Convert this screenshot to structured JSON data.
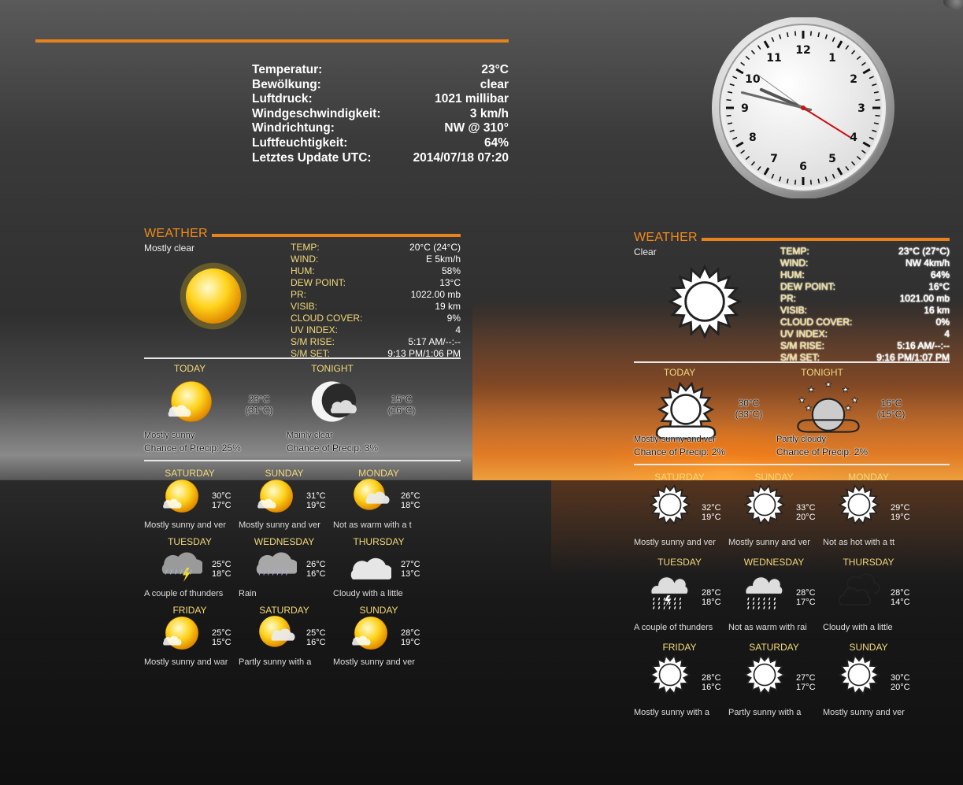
{
  "top_info": {
    "rows": [
      {
        "label": "Temperatur:",
        "value": "23°C"
      },
      {
        "label": "Bewölkung:",
        "value": "clear"
      },
      {
        "label": "Luftdruck:",
        "value": "1021 millibar"
      },
      {
        "label": "Windgeschwindigkeit:",
        "value": "3 km/h"
      },
      {
        "label": "Windrichtung:",
        "value": "NW @ 310°"
      },
      {
        "label": "Luftfeuchtigkeit:",
        "value": "64%"
      },
      {
        "label": "Letztes Update UTC:",
        "value": "2014/07/18 07:20"
      }
    ]
  },
  "clock": {
    "numbers": [
      "12",
      "1",
      "2",
      "3",
      "4",
      "5",
      "6",
      "7",
      "8",
      "9",
      "10",
      "11"
    ],
    "time": {
      "hour": 9,
      "minute": 47,
      "second": 21
    }
  },
  "left": {
    "title": "WEATHER",
    "condition": "Mostly clear",
    "stats": [
      {
        "label": "TEMP:",
        "value": "20°C (24°C)"
      },
      {
        "label": "WIND:",
        "value": "E 5km/h"
      },
      {
        "label": "HUM:",
        "value": "58%"
      },
      {
        "label": "DEW POINT:",
        "value": "13°C"
      },
      {
        "label": "PR:",
        "value": "1022.00 mb"
      },
      {
        "label": "VISIB:",
        "value": "19 km"
      },
      {
        "label": "CLOUD COVER:",
        "value": "9%"
      },
      {
        "label": "UV INDEX:",
        "value": "4"
      },
      {
        "label": "S/M RISE:",
        "value": "5:17 AM/--:--"
      },
      {
        "label": "S/M SET:",
        "value": "9:13 PM/1:06 PM"
      }
    ],
    "today": {
      "label": "TODAY",
      "hi": "23°C",
      "feel": "(31°C)",
      "desc": "Mostly sunny",
      "precip": "Chance of Precip: 25%"
    },
    "tonight": {
      "label": "TONIGHT",
      "hi": "15°C",
      "feel": "(16°C)",
      "desc": "Mainly clear",
      "precip": "Chance of Precip: 3%"
    },
    "forecast": [
      {
        "day": "SATURDAY",
        "hi": "30°C",
        "lo": "17°C",
        "desc": "Mostly sunny and ver",
        "icon": "sun"
      },
      {
        "day": "SUNDAY",
        "hi": "31°C",
        "lo": "19°C",
        "desc": "Mostly sunny and ver",
        "icon": "sun"
      },
      {
        "day": "MONDAY",
        "hi": "26°C",
        "lo": "18°C",
        "desc": "Not as warm with a t",
        "icon": "sun-cloud"
      },
      {
        "day": "TUESDAY",
        "hi": "25°C",
        "lo": "18°C",
        "desc": "A couple of thunders",
        "icon": "storm"
      },
      {
        "day": "WEDNESDAY",
        "hi": "26°C",
        "lo": "16°C",
        "desc": "Rain",
        "icon": "rain"
      },
      {
        "day": "THURSDAY",
        "hi": "27°C",
        "lo": "13°C",
        "desc": "Cloudy with a little",
        "icon": "cloud"
      },
      {
        "day": "FRIDAY",
        "hi": "25°C",
        "lo": "15°C",
        "desc": "Mostly sunny and war",
        "icon": "sun"
      },
      {
        "day": "SATURDAY",
        "hi": "25°C",
        "lo": "16°C",
        "desc": "Partly sunny with a",
        "icon": "sun-cloud"
      },
      {
        "day": "SUNDAY",
        "hi": "28°C",
        "lo": "19°C",
        "desc": "Mostly sunny and ver",
        "icon": "sun"
      }
    ]
  },
  "right": {
    "title": "WEATHER",
    "condition": "Clear",
    "stats": [
      {
        "label": "TEMP:",
        "value": "23°C (27°C)"
      },
      {
        "label": "WIND:",
        "value": "NW 4km/h"
      },
      {
        "label": "HUM:",
        "value": "64%"
      },
      {
        "label": "DEW POINT:",
        "value": "16°C"
      },
      {
        "label": "PR:",
        "value": "1021.00 mb"
      },
      {
        "label": "VISIB:",
        "value": "16 km"
      },
      {
        "label": "CLOUD COVER:",
        "value": "0%"
      },
      {
        "label": "UV INDEX:",
        "value": "4"
      },
      {
        "label": "S/M RISE:",
        "value": "5:16 AM/--:--"
      },
      {
        "label": "S/M SET:",
        "value": "9:16 PM/1:07 PM"
      }
    ],
    "today": {
      "label": "TODAY",
      "hi": "30°C",
      "feel": "(33°C)",
      "desc": "Mostly sunny and ver",
      "precip": "Chance of Precip: 2%"
    },
    "tonight": {
      "label": "TONIGHT",
      "hi": "16°C",
      "feel": "(15°C)",
      "desc": "Partly cloudy",
      "precip": "Chance of Precip: 2%"
    },
    "forecast": [
      {
        "day": "SATURDAY",
        "hi": "32°C",
        "lo": "19°C",
        "desc": "Mostly sunny and ver",
        "icon": "osun"
      },
      {
        "day": "SUNDAY",
        "hi": "33°C",
        "lo": "20°C",
        "desc": "Mostly sunny and ver",
        "icon": "osun"
      },
      {
        "day": "MONDAY",
        "hi": "29°C",
        "lo": "19°C",
        "desc": "Not as hot with a tt",
        "icon": "osun"
      },
      {
        "day": "TUESDAY",
        "hi": "28°C",
        "lo": "18°C",
        "desc": "A couple of thunders",
        "icon": "ostorm"
      },
      {
        "day": "WEDNESDAY",
        "hi": "28°C",
        "lo": "17°C",
        "desc": "Not as warm with rai",
        "icon": "orain"
      },
      {
        "day": "THURSDAY",
        "hi": "28°C",
        "lo": "14°C",
        "desc": "Cloudy with a little",
        "icon": "ocloud"
      },
      {
        "day": "FRIDAY",
        "hi": "28°C",
        "lo": "16°C",
        "desc": "Mostly sunny with a",
        "icon": "osun"
      },
      {
        "day": "SATURDAY",
        "hi": "27°C",
        "lo": "17°C",
        "desc": "Partly sunny with a",
        "icon": "osun"
      },
      {
        "day": "SUNDAY",
        "hi": "30°C",
        "lo": "20°C",
        "desc": "Mostly sunny and ver",
        "icon": "osun"
      }
    ]
  }
}
